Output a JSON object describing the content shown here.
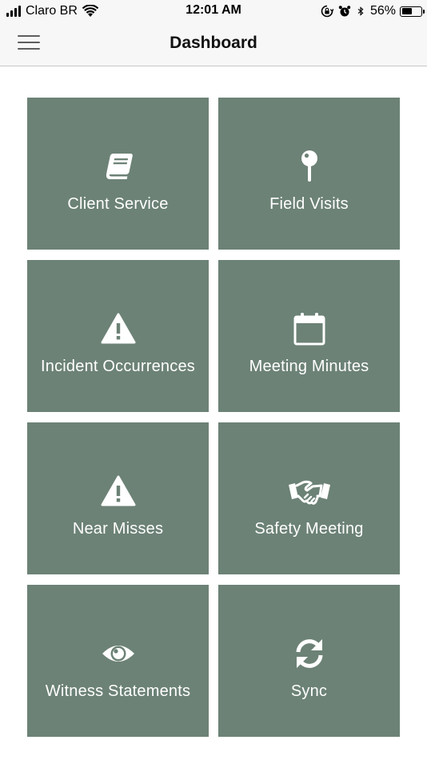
{
  "status_bar": {
    "carrier": "Claro BR",
    "time": "12:01 AM",
    "battery_percent": "56%",
    "battery_level": 0.56
  },
  "nav": {
    "title": "Dashboard",
    "menu_icon": "hamburger-icon"
  },
  "tiles": [
    {
      "label": "Client Service",
      "icon": "book-icon"
    },
    {
      "label": "Field Visits",
      "icon": "map-pin-icon"
    },
    {
      "label": "Incident Occurrences",
      "icon": "warning-icon"
    },
    {
      "label": "Meeting Minutes",
      "icon": "calendar-icon"
    },
    {
      "label": "Near Misses",
      "icon": "warning-icon"
    },
    {
      "label": "Safety Meeting",
      "icon": "handshake-icon"
    },
    {
      "label": "Witness Statements",
      "icon": "eye-icon"
    },
    {
      "label": "Sync",
      "icon": "sync-icon"
    }
  ],
  "colors": {
    "tile_background": "#6c8276",
    "tile_text": "#ffffff",
    "bar_background": "#f7f7f7"
  }
}
